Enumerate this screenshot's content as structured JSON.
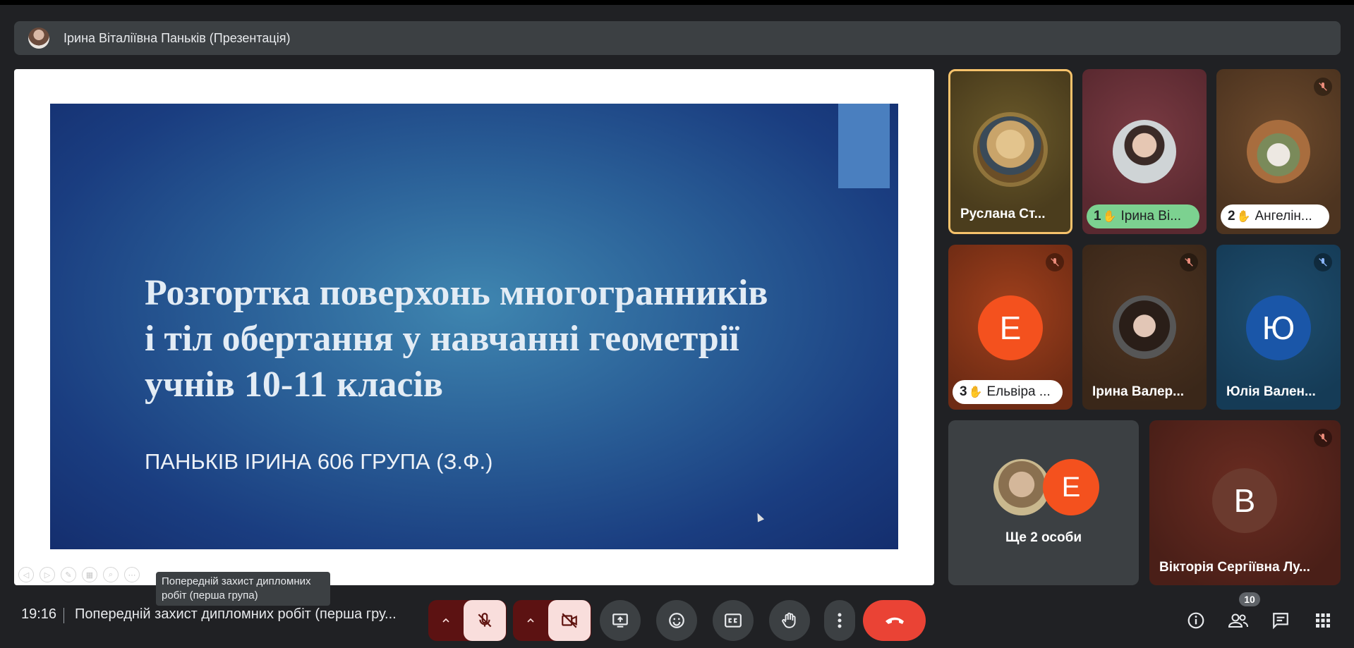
{
  "presenter_bar": {
    "label": "Ірина Віталіївна Паньків (Презентація)"
  },
  "slide": {
    "title_lines": [
      "Розгортка поверхонь многогранників",
      "і тіл обертання у навчанні геометрії",
      "учнів 10-11 класів"
    ],
    "subtitle": "ПАНЬКІВ ІРИНА 606 ГРУПА (З.Ф.)"
  },
  "tooltip": {
    "line1": "Попередній захист дипломних",
    "line2": "робіт (перша група)"
  },
  "participants": [
    {
      "name": "Руслана Ст...",
      "speaking": true
    },
    {
      "name": "Ірина Ві...",
      "hand_order": "1",
      "hand_color": "#7cd190"
    },
    {
      "name": "Ангелін...",
      "hand_order": "2",
      "muted": true
    },
    {
      "name": "Ельвіра ...",
      "hand_order": "3",
      "initial": "E",
      "initial_color": "#f4511e",
      "muted": true
    },
    {
      "name": "Ірина Валер...",
      "muted": true
    },
    {
      "name": "Юлія Вален...",
      "initial": "Ю",
      "initial_color": "#1a56a8",
      "muted": true
    },
    {
      "name": "Ще 2 особи",
      "initial": "E",
      "initial_color": "#f4511e"
    },
    {
      "name": "Вікторія Сергіївна Лу...",
      "initial": "В",
      "initial_color": "#6b3a2e",
      "muted": true
    }
  ],
  "bottom_bar": {
    "time": "19:16",
    "meeting_title": "Попередній захист дипломних робіт (перша гру...",
    "participants_count": "10",
    "icons": [
      "chevron-up-icon",
      "mic-off-icon",
      "videocam-off-icon",
      "present-screen-icon",
      "emoji-icon",
      "captions-icon",
      "raise-hand-icon",
      "more-vert-icon",
      "call-end-icon",
      "info-icon",
      "people-icon",
      "chat-icon",
      "apps-icon"
    ]
  },
  "colors": {
    "background": "#202124",
    "end_call": "#ea4335",
    "muted_group": "#5c1212",
    "speaking_border": "#f6c26b"
  }
}
